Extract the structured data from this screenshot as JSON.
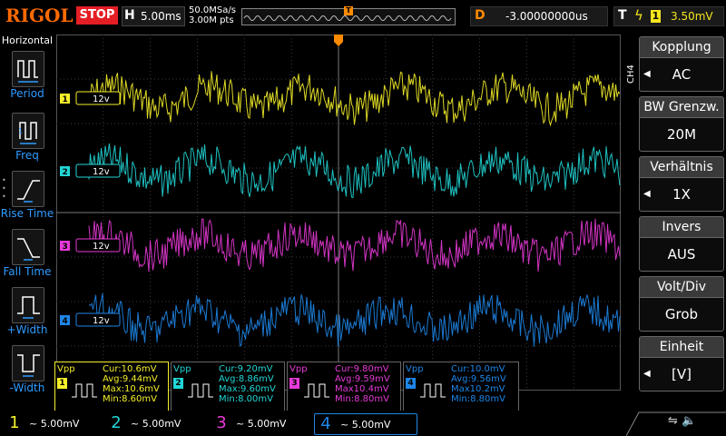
{
  "topbar": {
    "logo": "RIGOL",
    "run_state": "STOP",
    "horizontal_letter": "H",
    "timebase": "5.00ms",
    "sample_rate": "50.0MSa/s",
    "memory_depth": "3.00M pts",
    "trigger_marker": "T",
    "delay_letter": "D",
    "delay_value": "-3.00000000us",
    "trigger_letter": "T",
    "trigger_source": "1",
    "trigger_level": "3.50mV"
  },
  "left_menu": {
    "title": "Horizontal",
    "items": [
      {
        "label": "Period",
        "icon": "period-icon"
      },
      {
        "label": "Freq",
        "icon": "freq-icon"
      },
      {
        "label": "Rise Time",
        "icon": "rise-time-icon"
      },
      {
        "label": "Fall Time",
        "icon": "fall-time-icon"
      },
      {
        "label": "+Width",
        "icon": "pos-width-icon"
      },
      {
        "label": "-Width",
        "icon": "neg-width-icon"
      }
    ]
  },
  "channels": [
    {
      "num": "1",
      "label": "12v",
      "color": "#f5f02a"
    },
    {
      "num": "2",
      "label": "12v",
      "color": "#22d6d6"
    },
    {
      "num": "3",
      "label": "12v",
      "color": "#e83ad8"
    },
    {
      "num": "4",
      "label": "12v",
      "color": "#1e86e8"
    }
  ],
  "right_menu": {
    "channel_tag": "CH4",
    "items": [
      {
        "title": "Kopplung",
        "value": "AC",
        "has_arrow": true
      },
      {
        "title": "BW Grenzw.",
        "value": "20M",
        "has_arrow": false
      },
      {
        "title": "Verhältnis",
        "value": "1X",
        "has_arrow": true
      },
      {
        "title": "Invers",
        "value": "AUS",
        "has_arrow": false
      },
      {
        "title": "Volt/Div",
        "value": "Grob",
        "has_arrow": false
      },
      {
        "title": "Einheit",
        "value": "[V]",
        "has_arrow": true
      }
    ]
  },
  "measurements": [
    {
      "title": "Vpp",
      "num": "1",
      "color": "#f5f02a",
      "cur": "Cur:10.6mV",
      "avg": "Avg:9.44mV",
      "max": "Max:10.6mV",
      "min": "Min:8.60mV"
    },
    {
      "title": "Vpp",
      "num": "2",
      "color": "#22d6d6",
      "cur": "Cur:9.20mV",
      "avg": "Avg:8.86mV",
      "max": "Max:9.60mV",
      "min": "Min:8.00mV"
    },
    {
      "title": "Vpp",
      "num": "3",
      "color": "#e83ad8",
      "cur": "Cur:9.80mV",
      "avg": "Avg:9.59mV",
      "max": "Max10.4mV",
      "min": "Min:8.80mV"
    },
    {
      "title": "Vpp",
      "num": "4",
      "color": "#1e86e8",
      "cur": "Cur:10.0mV",
      "avg": "Avg:9.56mV",
      "max": "Max10.2mV",
      "min": "Min:8.80mV"
    }
  ],
  "bottom_channels": [
    {
      "num": "1",
      "value": "~ 5.00mV",
      "color": "#f5f02a"
    },
    {
      "num": "2",
      "value": "~ 5.00mV",
      "color": "#22d6d6"
    },
    {
      "num": "3",
      "value": "~ 5.00mV",
      "color": "#e83ad8"
    },
    {
      "num": "4",
      "value": "~ 5.00mV",
      "color": "#1e86e8"
    }
  ],
  "colors": {
    "accent_orange": "#ff6a00",
    "stop_red": "#e41e24",
    "menu_label_blue": "#2f9bff",
    "grid": "#555555"
  }
}
